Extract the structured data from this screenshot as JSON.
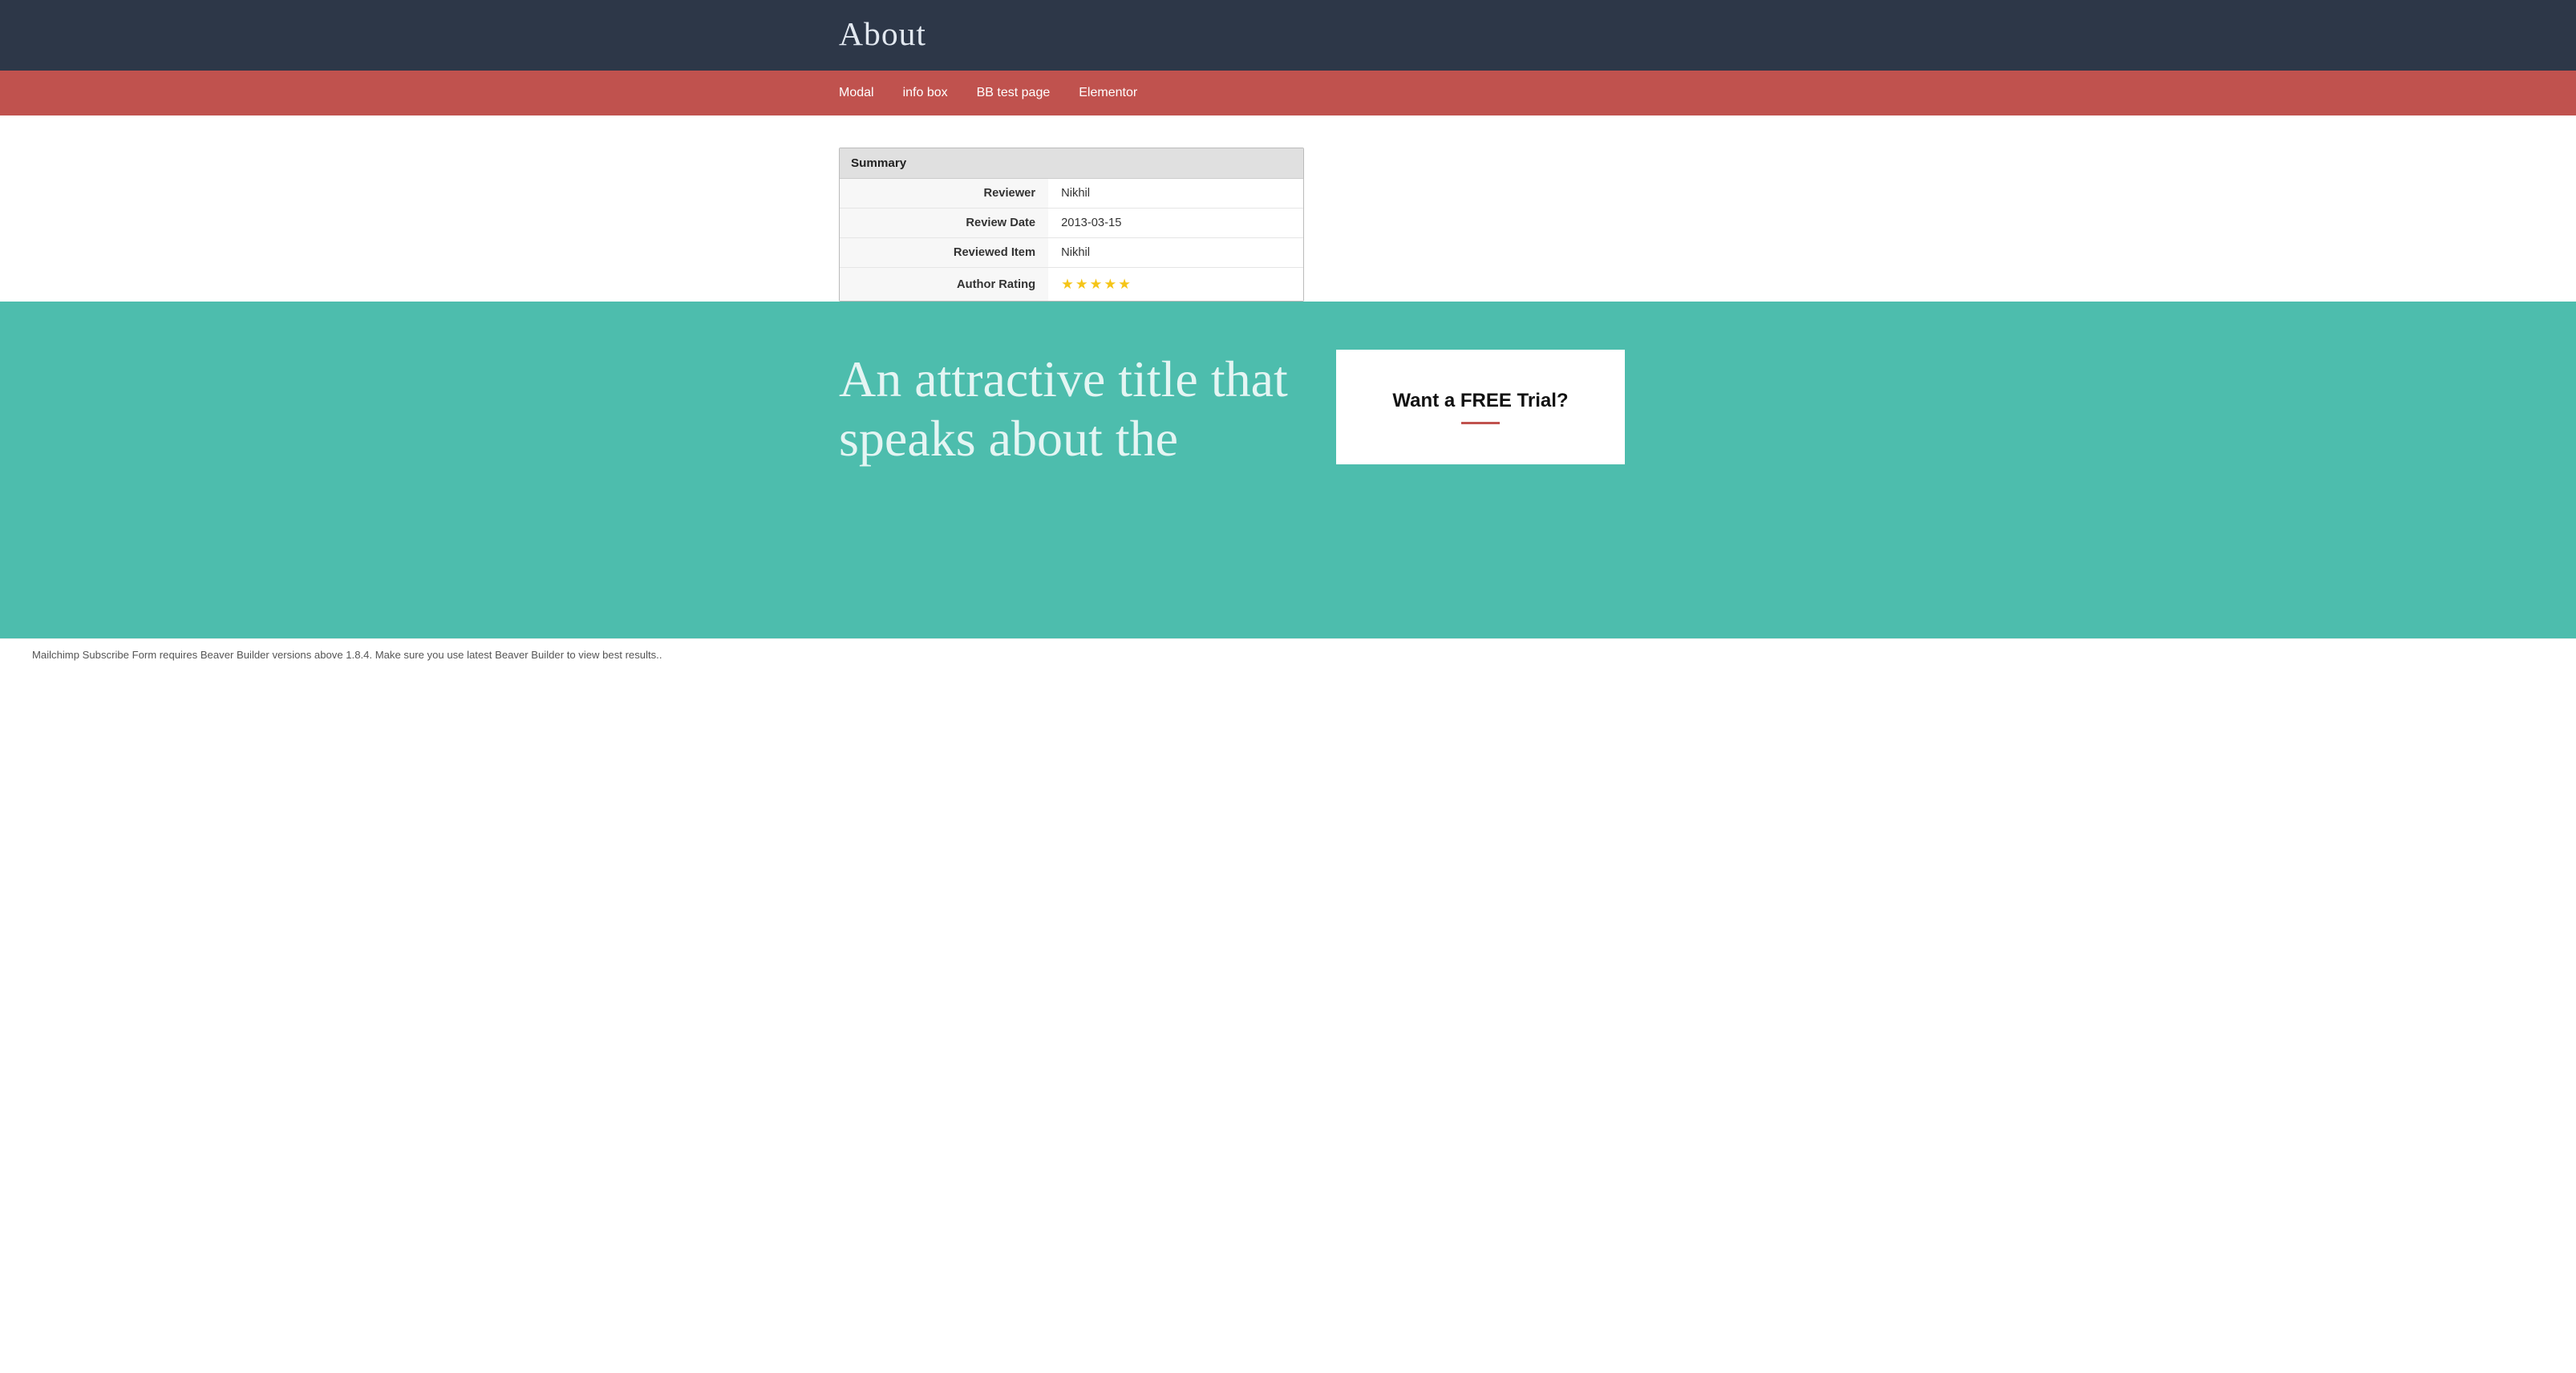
{
  "header": {
    "title": "About"
  },
  "navbar": {
    "items": [
      {
        "label": "Modal",
        "id": "modal"
      },
      {
        "label": "info box",
        "id": "info-box"
      },
      {
        "label": "BB test page",
        "id": "bb-test-page"
      },
      {
        "label": "Elementor",
        "id": "elementor"
      }
    ]
  },
  "summary": {
    "heading": "Summary",
    "rows": [
      {
        "label": "Reviewer",
        "value": "Nikhil"
      },
      {
        "label": "Review Date",
        "value": "2013-03-15"
      },
      {
        "label": "Reviewed Item",
        "value": "Nikhil"
      },
      {
        "label": "Author Rating",
        "value": "★★★★★",
        "type": "stars"
      }
    ]
  },
  "teal_section": {
    "title": "An attractive title that speaks about the",
    "free_trial_heading": "Want a FREE Trial?"
  },
  "footer_notice": "Mailchimp Subscribe Form requires Beaver Builder versions above 1.8.4. Make sure you use latest Beaver Builder to view best results.."
}
